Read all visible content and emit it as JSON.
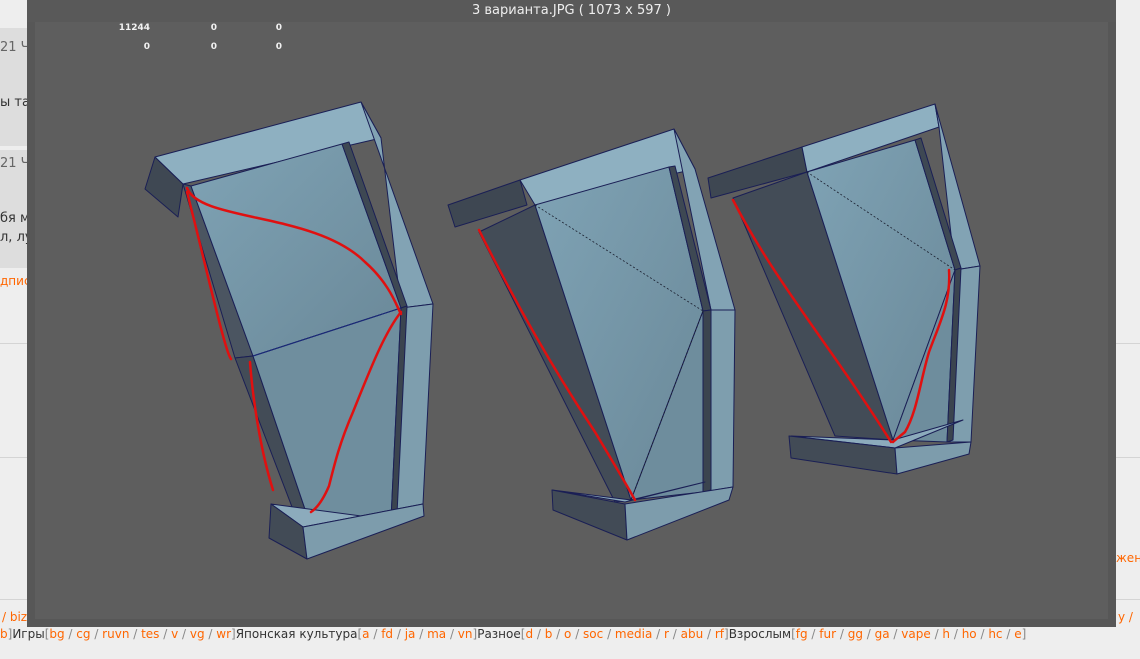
{
  "viewer": {
    "title": "3 варианта.JPG ( 1073 x 597 )"
  },
  "stats": [
    [
      "11244",
      "0",
      "0"
    ],
    [
      "0",
      "0",
      "0"
    ]
  ],
  "background": {
    "post1_time": "21 Ч",
    "post1_line": "ы там",
    "post2_time": "21 Ч",
    "post2_line1": "бя м",
    "post2_line2": "л, лу",
    "reply_link": "дпис",
    "right_link": "жени",
    "row1_left": "/  biz",
    "row1_right": "y  /"
  },
  "footer": {
    "lead_board": "b",
    "games_label": "Игры",
    "games": [
      "bg",
      "cg",
      "ruvn",
      "tes",
      "v",
      "vg",
      "wr"
    ],
    "japan_label": "Японская культура",
    "japan": [
      "a",
      "fd",
      "ja",
      "ma",
      "vn"
    ],
    "misc_label": "Разное",
    "misc": [
      "d",
      "b",
      "o",
      "soc",
      "media",
      "r",
      "abu",
      "rf"
    ],
    "adult_label": "Взрослым",
    "adult": [
      "fg",
      "fur",
      "gg",
      "ga",
      "vape",
      "h",
      "ho",
      "hc",
      "e"
    ]
  },
  "colors": {
    "face_light": "#8fb0c2",
    "face_mid": "#7a97a6",
    "face_dark": "#424c57",
    "edge": "#1a1f55",
    "stroke_red": "#e01010",
    "link_orange": "#ff6600"
  }
}
